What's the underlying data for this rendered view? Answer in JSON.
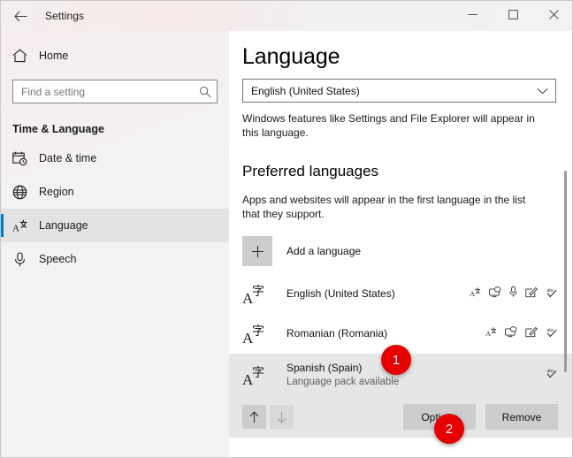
{
  "window": {
    "title": "Settings",
    "back_icon": "back-arrow-icon",
    "minimize_label": "Minimize",
    "maximize_label": "Maximize",
    "close_label": "Close"
  },
  "sidebar": {
    "home": {
      "label": "Home",
      "icon": "home-icon"
    },
    "search": {
      "placeholder": "Find a setting",
      "value": "",
      "icon": "search-icon"
    },
    "group_title": "Time & Language",
    "items": [
      {
        "label": "Date & time",
        "icon": "calendar-clock-icon",
        "selected": false
      },
      {
        "label": "Region",
        "icon": "globe-icon",
        "selected": false
      },
      {
        "label": "Language",
        "icon": "language-icon",
        "selected": true
      },
      {
        "label": "Speech",
        "icon": "microphone-icon",
        "selected": false
      }
    ],
    "accent_color": "#0078d7"
  },
  "main": {
    "page_title": "Language",
    "display_language": {
      "value": "English (United States)",
      "chevron_icon": "chevron-down-icon"
    },
    "display_language_note": "Windows features like Settings and File Explorer will appear in this language.",
    "preferred": {
      "title": "Preferred languages",
      "note": "Apps and websites will appear in the first language in the list that they support.",
      "add_label": "Add a language",
      "add_icon": "plus-icon",
      "languages": [
        {
          "name": "English (United States)",
          "sub": "",
          "icon": "language-script-icon",
          "selected": false,
          "features": [
            "language-pack-icon",
            "display-language-icon",
            "speech-icon",
            "handwriting-icon",
            "spellcheck-icon"
          ]
        },
        {
          "name": "Romanian (Romania)",
          "sub": "",
          "icon": "language-script-icon",
          "selected": false,
          "features": [
            "language-pack-icon",
            "display-language-icon",
            "handwriting-icon",
            "spellcheck-icon"
          ]
        },
        {
          "name": "Spanish (Spain)",
          "sub": "Language pack available",
          "icon": "language-script-icon",
          "selected": true,
          "features": [
            "spellcheck-icon"
          ]
        }
      ],
      "actions": {
        "move_up_icon": "arrow-up-icon",
        "move_down_icon": "arrow-down-icon",
        "move_up_enabled": true,
        "move_down_enabled": false,
        "options_label": "Options",
        "remove_label": "Remove"
      }
    }
  },
  "callouts": [
    {
      "id": "1",
      "label": "1",
      "color": "#e60000"
    },
    {
      "id": "2",
      "label": "2",
      "color": "#e60000"
    }
  ]
}
